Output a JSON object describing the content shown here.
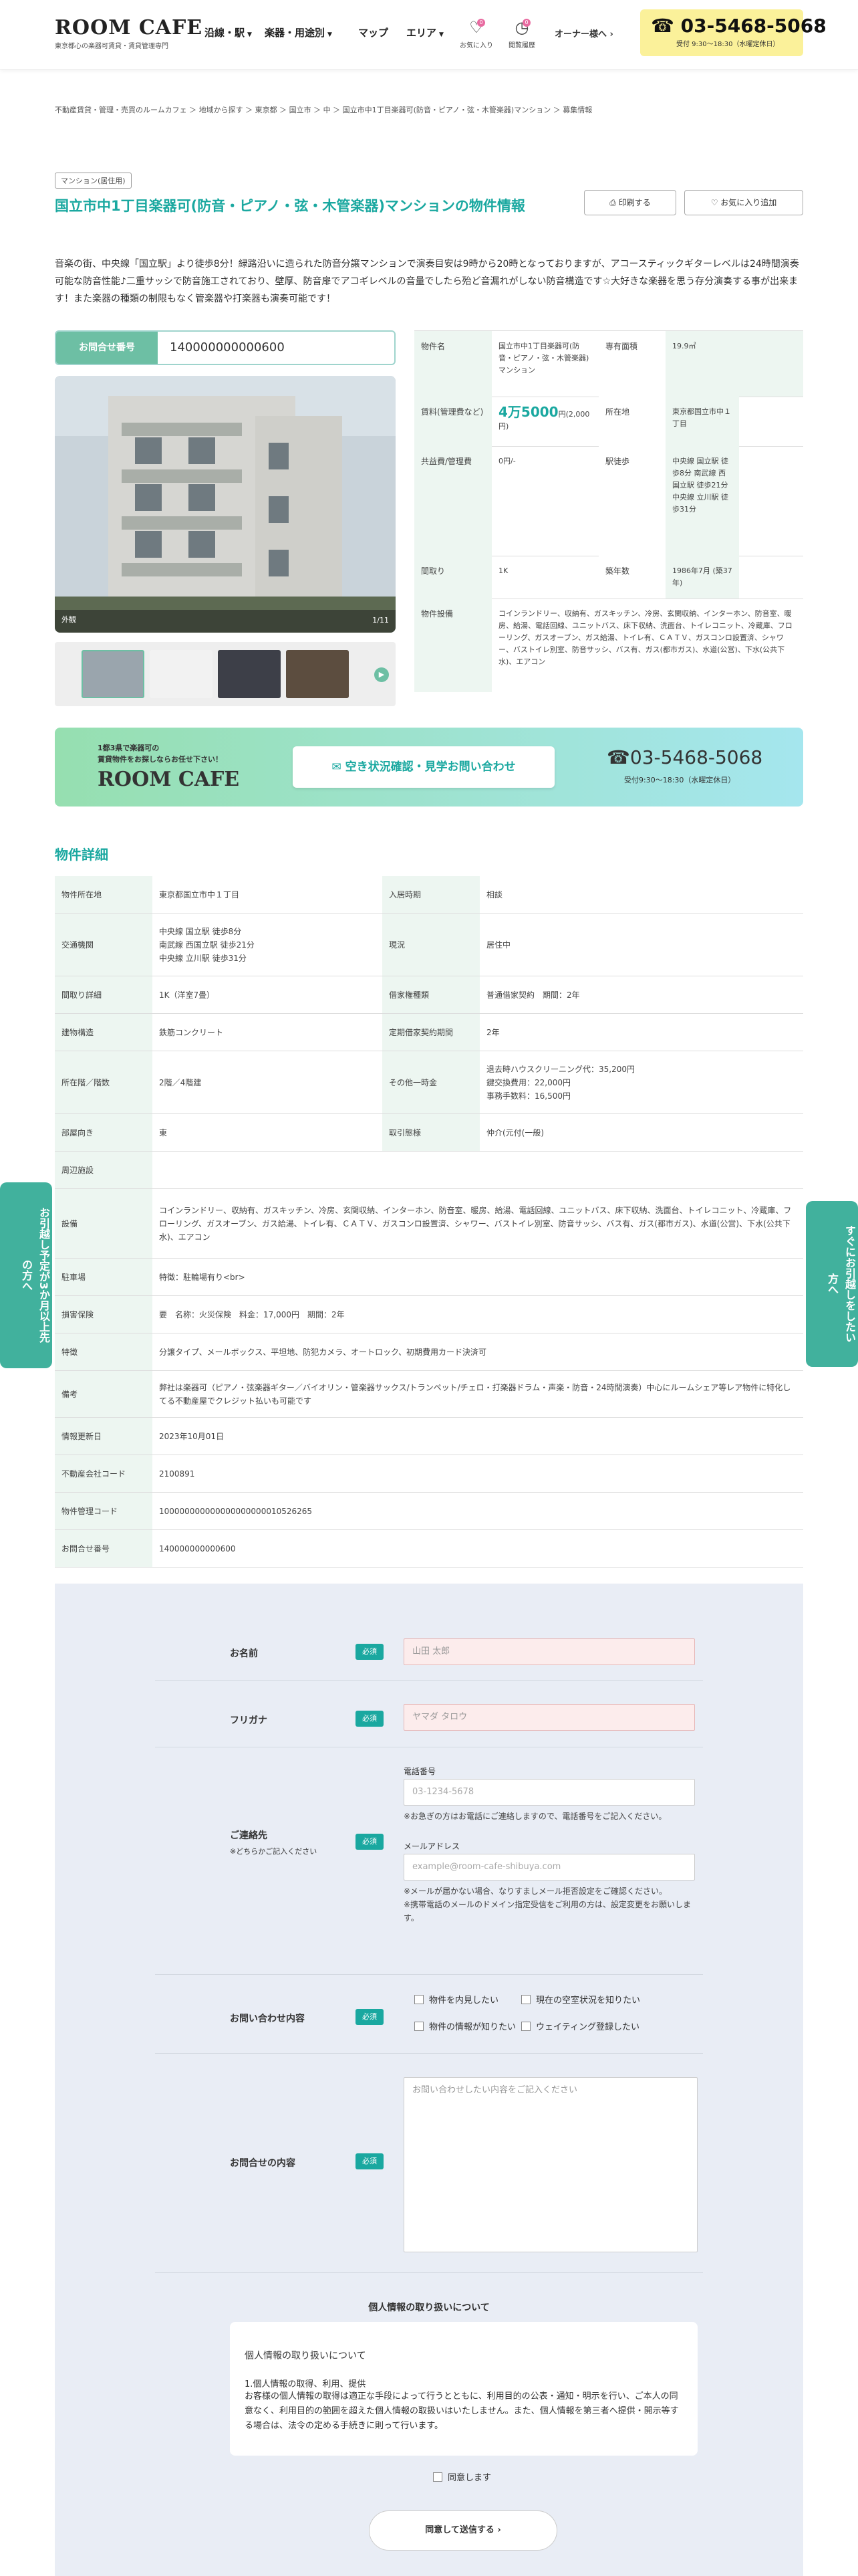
{
  "header": {
    "logo": "ROOM CAFE",
    "logo_sub": "東京都心の楽器可賃貸・賃貸管理専門",
    "nav": [
      "沿線・駅",
      "楽器・用途別",
      "マップ",
      "エリア"
    ],
    "fav_label": "お気に入り",
    "fav_count": "0",
    "history_label": "閲覧履歴",
    "history_count": "0",
    "owner_link": "オーナー様へ",
    "tel": "03-5468-5068",
    "hours": "受付 9:30〜18:30（水曜定休日）"
  },
  "breadcrumb": "不動産賃貸・管理・売買のルームカフェ ＞ 地域から探す ＞ 東京都 ＞ 国立市 ＞ 中 ＞ 国立市中1丁目楽器可(防音・ピアノ・弦・木管楽器)マンション ＞ 募集情報",
  "property": {
    "type_tag": "マンション(居住用)",
    "title": "国立市中1丁目楽器可(防音・ピアノ・弦・木管楽器)マンションの物件情報",
    "print_label": "印刷する",
    "fav_add_label": "お気に入り追加",
    "intro": "音楽の街、中央線「国立駅」より徒歩8分！緑路沿いに造られた防音分譲マンションで演奏目安は9時から20時となっておりますが、アコースティックギターレベルは24時間演奏可能な防音性能♪二重サッシで防音施工されており、壁厚、防音扉でアコギレベルの音量でしたら殆ど音漏れがしない防音構造です☆大好きな楽器を思う存分演奏する事が出来ます！また楽器の種類の制限もなく管楽器や打楽器も演奏可能です！",
    "inquiry_label": "お問合せ番号",
    "inquiry_no": "140000000000600",
    "photo_caption": "外観",
    "photo_counter": "1/11"
  },
  "summary": {
    "name_label": "物件名",
    "name": "国立市中1丁目楽器可(防音・ピアノ・弦・木管楽器)マンション",
    "area_label": "専有面積",
    "area": "19.9㎡",
    "rent_label": "賃料(管理費など)",
    "rent": "4万5000",
    "rent_extra": "円(2,000円)",
    "address_label": "所在地",
    "address": "東京都国立市中１丁目",
    "fees_label": "共益費/管理費",
    "fees": "0円/-",
    "station_label": "駅徒歩",
    "station": "中央線 国立駅 徒歩8分 南武線 西国立駅 徒歩21分 中央線 立川駅 徒歩31分",
    "layout_label": "間取り",
    "layout": "1K",
    "age_label": "築年数",
    "age": "1986年7月 (築37年)",
    "equip_label": "物件設備",
    "equip": "コインランドリー、収納有、ガスキッチン、冷房、玄関収納、インターホン、防音室、暖房、給湯、電話回線、ユニットバス、床下収納、洗面台、トイレコニット、冷蔵庫、フローリング、ガスオーブン、ガス給湯、トイレ有、ＣＡＴＶ、ガスコンロ設置済、シャワー、バストイレ別室、防音サッシ、バス有、ガス(都市ガス)、水道(公営)、下水(公共下水)、エアコン"
  },
  "banner": {
    "line1": "1都3県で楽器可の",
    "line2": "賃貸物件をお探しならお任せ下さい！",
    "logo": "ROOM CAFE",
    "cta": "空き状況確認・見学お問い合わせ",
    "tel": "03-5468-5068",
    "hours": "受付9:30〜18:30（水曜定休日）"
  },
  "details": {
    "title": "物件詳細",
    "rows": [
      {
        "k1": "物件所在地",
        "v1": "東京都国立市中１丁目",
        "k2": "入居時期",
        "v2": "相談"
      },
      {
        "k1": "交通機関",
        "v1": "中央線 国立駅 徒歩8分\n南武線 西国立駅 徒歩21分\n中央線 立川駅 徒歩31分",
        "k2": "現況",
        "v2": "居住中"
      },
      {
        "k1": "間取り詳細",
        "v1": "1K（洋室7畳）",
        "k2": "借家権種類",
        "v2": "普通借家契約　期間：2年"
      },
      {
        "k1": "建物構造",
        "v1": "鉄筋コンクリート",
        "k2": "定期借家契約期間",
        "v2": "2年"
      },
      {
        "k1": "所在階／階数",
        "v1": "2階／4階建",
        "k2": "その他一時金",
        "v2": "退去時ハウスクリーニング代：35,200円\n鍵交換費用：22,000円\n事務手数料：16,500円"
      },
      {
        "k1": "部屋向き",
        "v1": "東",
        "k2": "取引態様",
        "v2": "仲介(元付(一般)"
      },
      {
        "k1": "周辺施設",
        "v1": ""
      },
      {
        "k1": "設備",
        "v1": "コインランドリー、収納有、ガスキッチン、冷房、玄関収納、インターホン、防音室、暖房、給湯、電話回線、ユニットバス、床下収納、洗面台、トイレコニット、冷蔵庫、フローリング、ガスオーブン、ガス給湯、トイレ有、ＣＡＴＶ、ガスコンロ設置済、シャワー、バストイレ別室、防音サッシ、バス有、ガス(都市ガス)、水道(公営)、下水(公共下水)、エアコン"
      },
      {
        "k1": "駐車場",
        "v1": "特徴：駐輪場有り<br>"
      },
      {
        "k1": "損害保険",
        "v1": "要　名称：火災保険　料金：17,000円　期間：2年"
      },
      {
        "k1": "特徴",
        "v1": "分譲タイプ、メールボックス、平坦地、防犯カメラ、オートロック、初期費用カード決済可"
      },
      {
        "k1": "備考",
        "v1": "弊社は楽器可（ピアノ・弦楽器ギター／バイオリン・管楽器サックス/トランペット/チェロ・打楽器ドラム・声楽・防音・24時間演奏）中心にルームシェア等レア物件に特化してる不動産屋でクレジット払いも可能です"
      },
      {
        "k1": "情報更新日",
        "v1": "2023年10月01日"
      },
      {
        "k1": "不動産会社コード",
        "v1": "2100891"
      },
      {
        "k1": "物件管理コード",
        "v1": "100000000000000000000010526265"
      },
      {
        "k1": "お問合せ番号",
        "v1": "140000000000600"
      }
    ]
  },
  "side_left": "お引越し予定が3か月以上先の方へ",
  "side_right": "すぐにお引越しをしたい方へ",
  "form": {
    "required": "必須",
    "name_label": "お名前",
    "name_ph": "山田 太郎",
    "kana_label": "フリガナ",
    "kana_ph": "ヤマダ タロウ",
    "contact_label": "ご連絡先",
    "contact_sub": "※どちらかご記入ください",
    "tel_label": "電話番号",
    "tel_ph": "03-1234-5678",
    "tel_note": "※お急ぎの方はお電話にご連絡しますので、電話番号をご記入ください。",
    "mail_label": "メールアドレス",
    "mail_ph": "example@room-cafe-shibuya.com",
    "mail_note": "※メールが届かない場合、なりすましメール拒否設定をご確認ください。\n※携帯電話のメールのドメイン指定受信をご利用の方は、設定変更をお願いします。",
    "type_label": "お問い合わせ内容",
    "type_opts": [
      "物件を内見したい",
      "現在の空室状況を知りたい",
      "物件の情報が知りたい",
      "ウェイティング登録したい"
    ],
    "body_label": "お問合せの内容",
    "body_ph": "お問い合わせしたい内容をご記入ください",
    "privacy_title": "個人情報の取り扱いについて",
    "privacy_heading": "個人情報の取り扱いについて",
    "privacy_sub": "1.個人情報の取得、利用、提供",
    "privacy_text": "お客様の個人情報の取得は適正な手段によって行うとともに、利用目的の公表・通知・明示を行い、ご本人の同意なく、利用目的の範囲を超えた個人情報の取扱いはいたしません。また、個人情報を第三者へ提供・開示等する場合は、法令の定める手続きに則って行います。",
    "agree": "同意します",
    "submit": "同意して送信する"
  },
  "colors": {
    "accent": "#1aa8a0",
    "tel_bg": "#fbf19a",
    "label_bg": "#edf6f1",
    "side": "#41b19d"
  }
}
